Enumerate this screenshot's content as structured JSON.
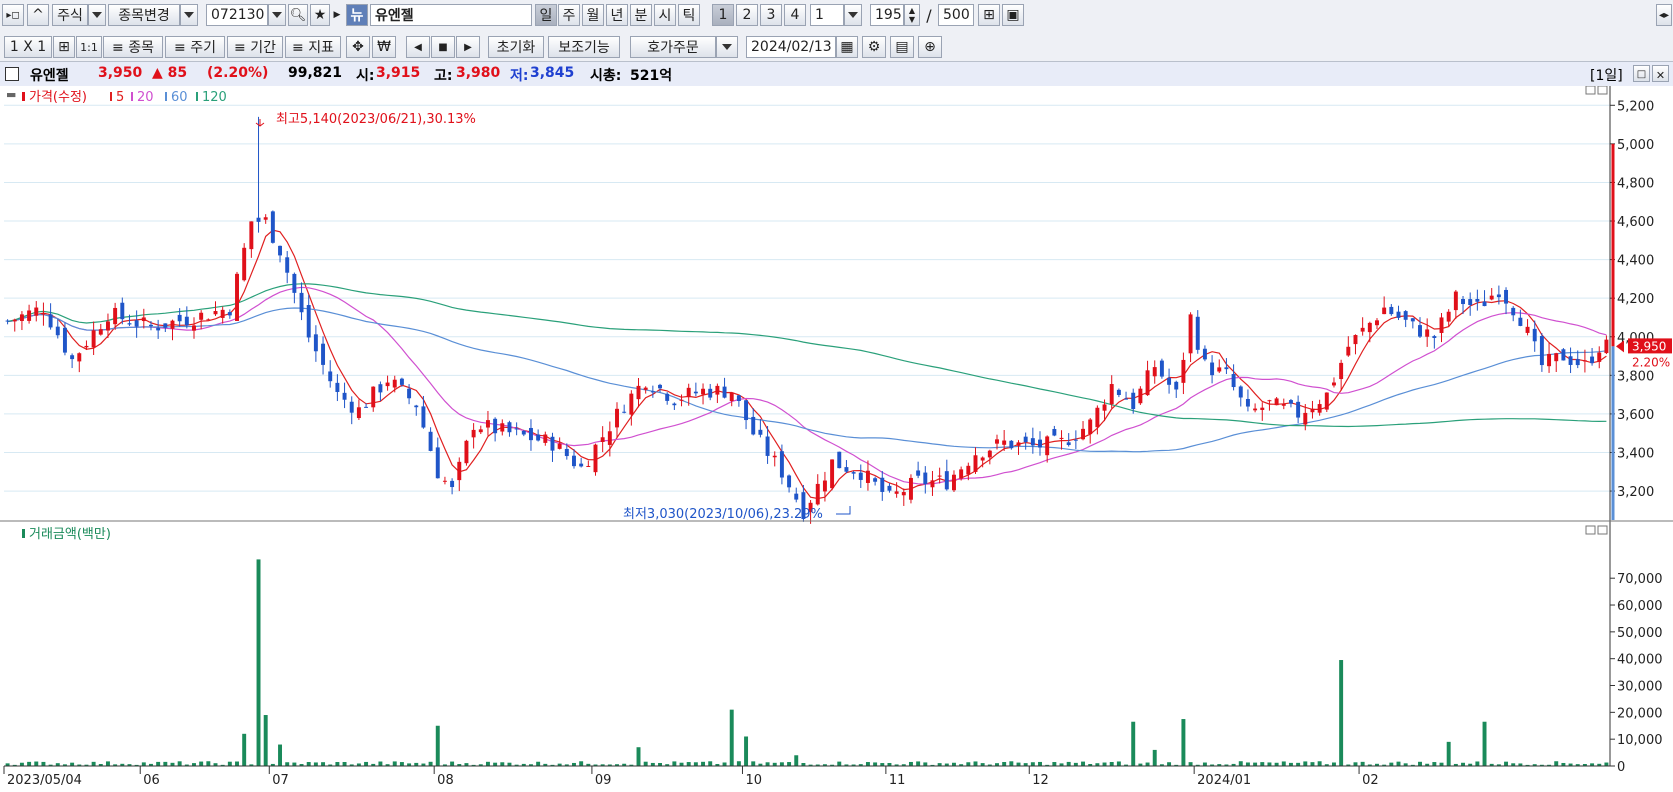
{
  "toolbar1": {
    "market": "주식",
    "change_label": "종목변경",
    "code": "072130",
    "name_tag": "뉴",
    "stock_name": "유엔젤",
    "periods": [
      "일",
      "주",
      "월",
      "년",
      "분",
      "시",
      "틱"
    ],
    "units": [
      "1",
      "2",
      "3",
      "4"
    ],
    "unit_value": "1",
    "count": "195",
    "slash": "/",
    "max_count": "500"
  },
  "toolbar2": {
    "layout": "1 X 1",
    "ratio": "1:1",
    "menus": [
      "≡ 종목",
      "≡ 주기",
      "≡ 기간",
      "≡ 지표"
    ],
    "reset": "초기화",
    "aux": "보조기능",
    "order": "호가주문",
    "date": "2024/02/13"
  },
  "info": {
    "name": "유엔젤",
    "price": "3,950",
    "change": "▲ 85",
    "change_pct": "(2.20%)",
    "volume": "99,821",
    "open_label": "시:",
    "open": "3,915",
    "high_label": "고:",
    "high": "3,980",
    "low_label": "저:",
    "low": "3,845",
    "cap_label": "시총:",
    "cap": "521억",
    "period_tag": "[1일]"
  },
  "price_legend": {
    "title": "가격(수정)",
    "ma": [
      {
        "label": "5",
        "color": "#e02020"
      },
      {
        "label": "20",
        "color": "#d050d0"
      },
      {
        "label": "60",
        "color": "#5a8fd6"
      },
      {
        "label": "120",
        "color": "#2aa07a"
      }
    ]
  },
  "annotations": {
    "high": "최고5,140(2023/06/21),30.13%",
    "low": "최저3,030(2023/10/06),23.29%"
  },
  "price_tag": {
    "price": "3,950",
    "pct": "2.20%"
  },
  "volume_legend": {
    "title": "거래금액(백만)"
  },
  "colors": {
    "up": "#e0101a",
    "down": "#1f55c8",
    "volume": "#1a8a5a",
    "bg": "#ffffff",
    "grid": "#d7e9f3"
  },
  "chart_data": [
    {
      "type": "candlestick",
      "title": "가격(수정)",
      "yticks": [
        5200,
        5000,
        4800,
        4600,
        4400,
        4200,
        4000,
        3800,
        3600,
        3400,
        3200
      ],
      "ylim": [
        3050,
        5300
      ],
      "grid": true,
      "xticks": [
        "2023/05/04",
        "06",
        "07",
        "08",
        "09",
        "10",
        "11",
        "12",
        "2024/01",
        "02"
      ],
      "ohlc_anchors": [
        {
          "pos": 0,
          "close": 4080
        },
        {
          "pos": 5,
          "close": 4150
        },
        {
          "pos": 9,
          "close": 3880
        },
        {
          "pos": 14,
          "close": 4120
        },
        {
          "pos": 20,
          "close": 4050
        },
        {
          "pos": 27,
          "close": 4110
        },
        {
          "pos": 31,
          "close": 4150
        },
        {
          "pos": 34,
          "close": 4600
        },
        {
          "pos": 36,
          "close": 4600
        },
        {
          "pos": 38,
          "close": 4450
        },
        {
          "pos": 42,
          "close": 4000
        },
        {
          "pos": 46,
          "close": 3700
        },
        {
          "pos": 49,
          "close": 3620
        },
        {
          "pos": 53,
          "close": 3780
        },
        {
          "pos": 57,
          "close": 3650
        },
        {
          "pos": 60,
          "close": 3300
        },
        {
          "pos": 62,
          "close": 3200
        },
        {
          "pos": 65,
          "close": 3550
        },
        {
          "pos": 70,
          "close": 3500
        },
        {
          "pos": 76,
          "close": 3450
        },
        {
          "pos": 80,
          "close": 3320
        },
        {
          "pos": 86,
          "close": 3650
        },
        {
          "pos": 89,
          "close": 3780
        },
        {
          "pos": 93,
          "close": 3680
        },
        {
          "pos": 97,
          "close": 3720
        },
        {
          "pos": 101,
          "close": 3720
        },
        {
          "pos": 104,
          "close": 3500
        },
        {
          "pos": 108,
          "close": 3300
        },
        {
          "pos": 111,
          "close": 3100
        },
        {
          "pos": 115,
          "close": 3350
        },
        {
          "pos": 119,
          "close": 3300
        },
        {
          "pos": 123,
          "close": 3160
        },
        {
          "pos": 127,
          "close": 3250
        },
        {
          "pos": 131,
          "close": 3250
        },
        {
          "pos": 135,
          "close": 3400
        },
        {
          "pos": 139,
          "close": 3450
        },
        {
          "pos": 143,
          "close": 3430
        },
        {
          "pos": 147,
          "close": 3450
        },
        {
          "pos": 151,
          "close": 3550
        },
        {
          "pos": 154,
          "close": 3750
        },
        {
          "pos": 157,
          "close": 3650
        },
        {
          "pos": 160,
          "close": 3850
        },
        {
          "pos": 163,
          "close": 3700
        },
        {
          "pos": 165,
          "close": 4100
        },
        {
          "pos": 167,
          "close": 3850
        },
        {
          "pos": 170,
          "close": 3800
        },
        {
          "pos": 173,
          "close": 3600
        },
        {
          "pos": 176,
          "close": 3650
        },
        {
          "pos": 180,
          "close": 3600
        },
        {
          "pos": 184,
          "close": 3700
        },
        {
          "pos": 187,
          "close": 3950
        },
        {
          "pos": 192,
          "close": 4150
        },
        {
          "pos": 196,
          "close": 4050
        },
        {
          "pos": 199,
          "close": 4000
        },
        {
          "pos": 202,
          "close": 4200
        },
        {
          "pos": 205,
          "close": 4150
        },
        {
          "pos": 208,
          "close": 4250
        },
        {
          "pos": 211,
          "close": 4100
        },
        {
          "pos": 214,
          "close": 3850
        },
        {
          "pos": 217,
          "close": 3900
        },
        {
          "pos": 220,
          "close": 3850
        },
        {
          "pos": 222,
          "close": 3950
        }
      ],
      "highlights": [
        {
          "label": "최고",
          "value": 5140,
          "date": "2023/06/21"
        },
        {
          "label": "최저",
          "value": 3030,
          "date": "2023/10/06"
        }
      ],
      "moving_averages": [
        "5",
        "20",
        "60",
        "120"
      ]
    },
    {
      "type": "bar",
      "title": "거래금액(백만)",
      "yticks": [
        70000,
        60000,
        50000,
        40000,
        30000,
        20000,
        10000,
        0
      ],
      "ylim": [
        0,
        82000
      ],
      "spikes": [
        {
          "pos": 35,
          "value": 77000
        },
        {
          "pos": 36,
          "value": 19000
        },
        {
          "pos": 33,
          "value": 12000
        },
        {
          "pos": 38,
          "value": 8000
        },
        {
          "pos": 60,
          "value": 15000
        },
        {
          "pos": 88,
          "value": 7000
        },
        {
          "pos": 101,
          "value": 21000
        },
        {
          "pos": 103,
          "value": 11000
        },
        {
          "pos": 110,
          "value": 4000
        },
        {
          "pos": 157,
          "value": 16500
        },
        {
          "pos": 164,
          "value": 17500
        },
        {
          "pos": 186,
          "value": 39500
        },
        {
          "pos": 201,
          "value": 9000
        },
        {
          "pos": 206,
          "value": 16500
        },
        {
          "pos": 160,
          "value": 6000
        }
      ]
    }
  ]
}
